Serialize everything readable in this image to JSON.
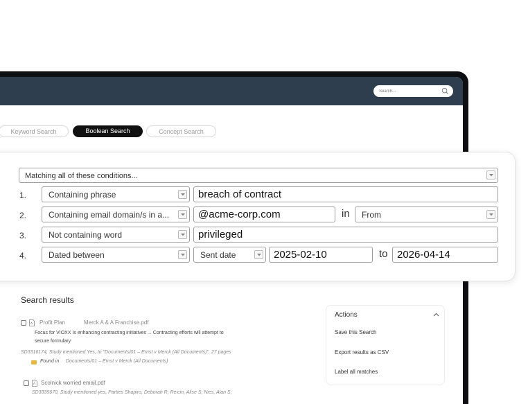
{
  "header": {
    "search_placeholder": "Search..."
  },
  "tabs": [
    {
      "label": "Keyword Search",
      "active": false
    },
    {
      "label": "Boolean Search",
      "active": true
    },
    {
      "label": "Concept Search",
      "active": false
    }
  ],
  "query": {
    "match_mode": "Matching all of these conditions...",
    "conditions": [
      {
        "number": "1.",
        "operator": "Containing phrase",
        "value": "breach of contract"
      },
      {
        "number": "2.",
        "operator": "Containing email domain/s in a...",
        "value": "@acme-corp.com",
        "joiner": "in",
        "field": "From"
      },
      {
        "number": "3.",
        "operator": "Not containing word",
        "value": "privileged"
      },
      {
        "number": "4.",
        "operator": "Dated between",
        "date_field": "Sent date",
        "from": "2025-02-10",
        "joiner": "to",
        "to": "2026-04-14"
      }
    ]
  },
  "results": {
    "title": "Search results",
    "items": [
      {
        "name": "Profit Plan",
        "source": "Merck A & A Franchise.pdf",
        "snippet_1": "Focus for VIOXX Is enhancing contracting initiatives ... Contracting efforts will attempt to",
        "snippet_2": "secure formulary",
        "meta": "SD3316174, Study mentioned Yes, In \"Documents/01 – Ernst v Merck (All Documents)\", 27 pages",
        "found_label": "Found in",
        "found_path": "Documents/01 – Ernst v Merck (All Documents)"
      },
      {
        "name": "Scolnick worried email.pdf",
        "meta": "SD3335670, Study mentioned yes, Parties Shapiro, Deborah R; Reicin, Alise S; Nies, Alan S;"
      }
    ]
  },
  "actions": {
    "title": "Actions",
    "items": [
      "Save this Search",
      "Export results as CSV",
      "Label all matches"
    ]
  },
  "colors": {
    "topbar": "#2f3e4e",
    "active_tab": "#111111",
    "device_frame": "#0d0f12"
  }
}
